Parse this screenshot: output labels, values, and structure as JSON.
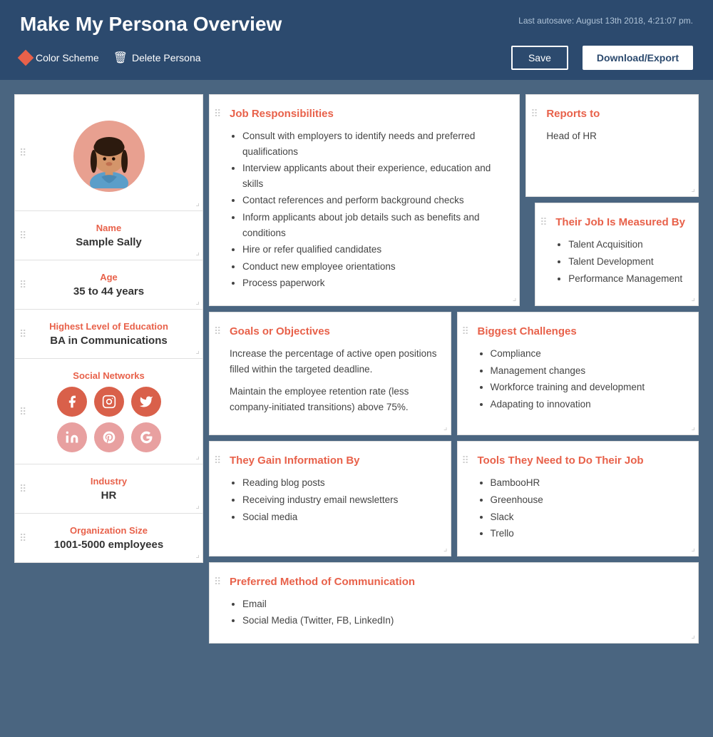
{
  "header": {
    "title": "Make My Persona Overview",
    "autosave": "Last autosave: August 13th 2018, 4:21:07 pm.",
    "color_scheme_label": "Color Scheme",
    "delete_persona_label": "Delete Persona",
    "save_label": "Save",
    "download_label": "Download/Export"
  },
  "persona": {
    "name_label": "Name",
    "name_value": "Sample Sally",
    "age_label": "Age",
    "age_value": "35 to 44 years",
    "education_label": "Highest Level of Education",
    "education_value": "BA in Communications",
    "social_label": "Social Networks",
    "industry_label": "Industry",
    "industry_value": "HR",
    "org_size_label": "Organization Size",
    "org_size_value": "1001-5000 employees"
  },
  "cards": {
    "job_responsibilities": {
      "title": "Job Responsibilities",
      "items": [
        "Consult with employers to identify needs and preferred qualifications",
        "Interview applicants about their experience, education and skills",
        "Contact references and perform background checks",
        "Inform applicants about job details such as benefits and conditions",
        "Hire or refer qualified candidates",
        "Conduct new employee orientations",
        "Process paperwork"
      ]
    },
    "reports_to": {
      "title": "Reports to",
      "value": "Head of HR"
    },
    "job_measured_by": {
      "title": "Their Job Is Measured By",
      "items": [
        "Talent Acquisition",
        "Talent Development",
        "Performance Management"
      ]
    },
    "goals": {
      "title": "Goals or Objectives",
      "paragraphs": [
        "Increase the percentage of active open positions filled within the targeted deadline.",
        "Maintain the employee retention rate (less company-initiated transitions) above 75%."
      ]
    },
    "challenges": {
      "title": "Biggest Challenges",
      "items": [
        "Compliance",
        "Management changes",
        "Workforce training and development",
        "Adapating to innovation"
      ]
    },
    "information": {
      "title": "They Gain Information By",
      "items": [
        "Reading blog posts",
        "Receiving industry email newsletters",
        "Social media"
      ]
    },
    "tools": {
      "title": "Tools They Need to Do Their Job",
      "items": [
        "BambooHR",
        "Greenhouse",
        "Slack",
        "Trello"
      ]
    },
    "communication": {
      "title": "Preferred Method of Communication",
      "items": [
        "Email",
        "Social Media (Twitter, FB, LinkedIn)"
      ]
    }
  },
  "drag_handle_char": "⠿",
  "resize_char": "⌟",
  "icons": {
    "facebook": "f",
    "instagram": "in",
    "twitter": "t",
    "linkedin": "in",
    "pinterest": "p",
    "googleplus": "g+"
  }
}
